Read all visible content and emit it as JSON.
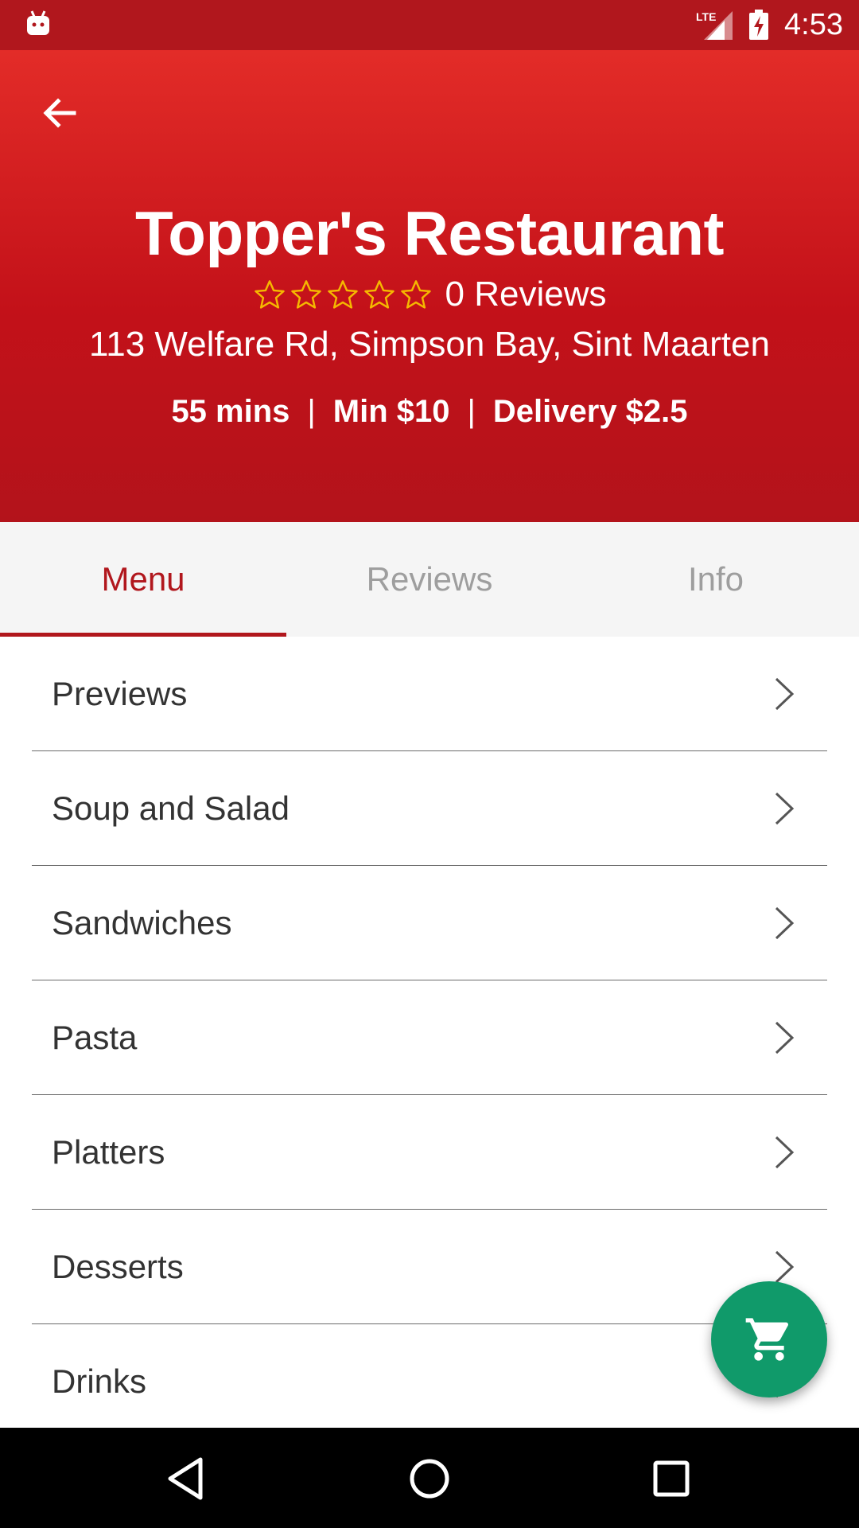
{
  "status_bar": {
    "time": "4:53",
    "network_label": "LTE"
  },
  "header": {
    "restaurant_name": "Topper's Restaurant",
    "rating_stars": 0,
    "rating_max": 5,
    "review_count": "0 Reviews",
    "address": "113 Welfare Rd, Simpson Bay, Sint Maarten",
    "delivery_time": "55 mins",
    "minimum_order": "Min $10",
    "delivery_fee": "Delivery $2.5",
    "separator": "|"
  },
  "tabs": [
    {
      "label": "Menu",
      "active": true
    },
    {
      "label": "Reviews",
      "active": false
    },
    {
      "label": "Info",
      "active": false
    }
  ],
  "menu": {
    "items": [
      {
        "label": "Previews"
      },
      {
        "label": "Soup and Salad"
      },
      {
        "label": "Sandwiches"
      },
      {
        "label": "Pasta"
      },
      {
        "label": "Platters"
      },
      {
        "label": "Desserts"
      },
      {
        "label": "Drinks"
      }
    ]
  },
  "colors": {
    "primary": "#c31119",
    "primary_dark": "#b1171d",
    "star_outline": "#f5b800",
    "fab": "#109a6a"
  },
  "icons": {
    "back": "arrow-left-icon",
    "chevron": "chevron-right-icon",
    "cart": "shopping-cart-icon"
  }
}
